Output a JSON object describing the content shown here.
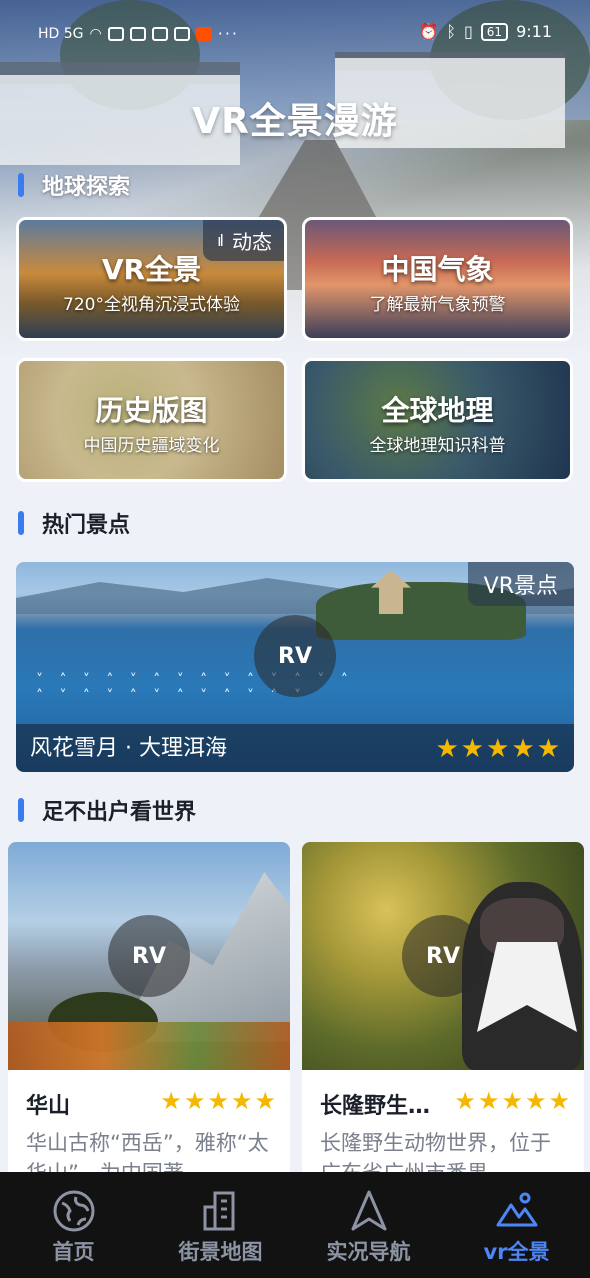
{
  "status_bar": {
    "left_text": "HD 5G",
    "battery": "61",
    "time": "9:11"
  },
  "app": {
    "title": "VR全景漫游"
  },
  "sections": {
    "explore": "地球探索",
    "hot": "热门景点",
    "world": "足不出户看世界"
  },
  "explore_cards": [
    {
      "title": "VR全景",
      "subtitle": "720°全视角沉浸式体验",
      "badge": "动态"
    },
    {
      "title": "中国气象",
      "subtitle": "了解最新气象预警"
    },
    {
      "title": "历史版图",
      "subtitle": "中国历史疆域变化"
    },
    {
      "title": "全球地理",
      "subtitle": "全球地理知识科普"
    }
  ],
  "hot_spot": {
    "badge": "VR景点",
    "rv": "RV",
    "name": "风花雪月 · 大理洱海",
    "rating": 5
  },
  "places": [
    {
      "title": "华山",
      "rv": "RV",
      "rating": 5,
      "desc": "华山古称“西岳”，雅称“太华山”，为中国著"
    },
    {
      "title": "长隆野生…",
      "rv": "RV",
      "rating": 5,
      "desc": "长隆野生动物世界，位于广东省广州市番禺"
    }
  ],
  "nav": [
    {
      "label": "首页",
      "icon": "globe-icon"
    },
    {
      "label": "街景地图",
      "icon": "building-icon"
    },
    {
      "label": "实况导航",
      "icon": "navigation-arrow-icon"
    },
    {
      "label": "vr全景",
      "icon": "mountain-icon",
      "active": true
    }
  ],
  "colors": {
    "accent": "#3b7bf0",
    "nav_active": "#4d86f7",
    "star": "#f5b800"
  }
}
